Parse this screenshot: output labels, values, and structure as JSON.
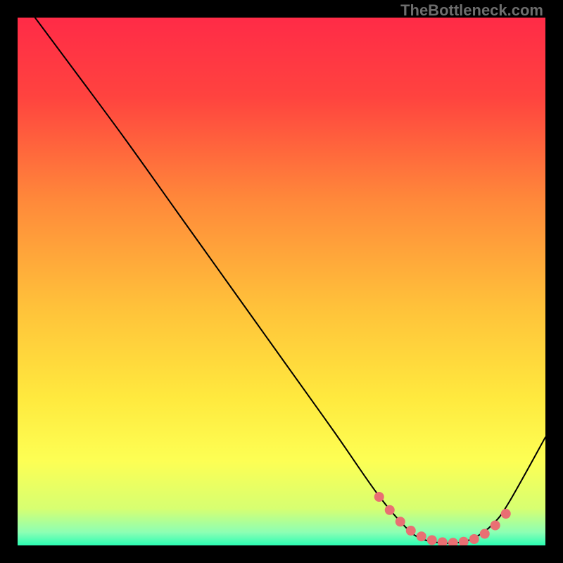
{
  "watermark": "TheBottleneck.com",
  "chart_data": {
    "type": "line",
    "title": "",
    "xlabel": "",
    "ylabel": "",
    "xlim": [
      0,
      100
    ],
    "ylim": [
      0,
      100
    ],
    "legend": false,
    "grid": false,
    "background_gradient": {
      "stops": [
        {
          "offset": 0.0,
          "color": "#ff2b47"
        },
        {
          "offset": 0.15,
          "color": "#ff433f"
        },
        {
          "offset": 0.35,
          "color": "#ff8a3a"
        },
        {
          "offset": 0.55,
          "color": "#ffc23a"
        },
        {
          "offset": 0.72,
          "color": "#ffe93e"
        },
        {
          "offset": 0.84,
          "color": "#fdff54"
        },
        {
          "offset": 0.93,
          "color": "#d7ff71"
        },
        {
          "offset": 0.975,
          "color": "#8dffb4"
        },
        {
          "offset": 1.0,
          "color": "#2bfdb3"
        }
      ]
    },
    "series": [
      {
        "name": "bottleneck-curve",
        "color": "#000000",
        "stroke_width": 2,
        "x": [
          3.3,
          10,
          20,
          30,
          40,
          50,
          60,
          68,
          73,
          76,
          80,
          84,
          87,
          90,
          93,
          100
        ],
        "values": [
          100,
          91,
          77.5,
          63.5,
          49.5,
          35.5,
          21.5,
          10,
          4,
          1.5,
          0.5,
          0.6,
          1.7,
          4,
          8,
          20.5
        ]
      },
      {
        "name": "optimal-zone-dots",
        "type": "scatter",
        "color": "#e96f73",
        "marker_radius": 7,
        "x": [
          68.5,
          70.5,
          72.5,
          74.5,
          76.5,
          78.5,
          80.5,
          82.5,
          84.5,
          86.5,
          88.5,
          90.5,
          92.5
        ],
        "values": [
          9.2,
          6.7,
          4.5,
          2.8,
          1.7,
          1.0,
          0.6,
          0.5,
          0.7,
          1.2,
          2.2,
          3.8,
          6.0
        ]
      }
    ]
  }
}
